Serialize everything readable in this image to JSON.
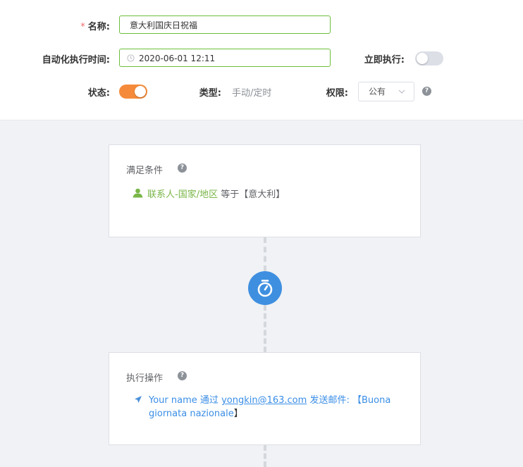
{
  "form": {
    "name_label": "名称:",
    "name_required_mark": "*",
    "name_value": "意大利国庆日祝福",
    "time_label": "自动化执行时间:",
    "time_value": "2020-06-01 12:11",
    "run_now_label": "立即执行:",
    "run_now_on": false,
    "status_label": "状态:",
    "status_on": true,
    "type_label": "类型:",
    "type_value": "手动/定时",
    "permission_label": "权限:",
    "permission_value": "公有"
  },
  "condition_card": {
    "title": "满足条件",
    "field": "联系人-国家/地区",
    "operator": "等于",
    "value": "【意大利】"
  },
  "action_card": {
    "title": "执行操作",
    "sender": "Your name",
    "via": "通过",
    "email": "yongkin@163.com",
    "action": "发送邮件:",
    "subject_line1": "【Buona",
    "subject_line2": "giornata nazionale",
    "subject_close": "】"
  },
  "colors": {
    "accent_green": "#6cbf3c",
    "toggle_on": "#f58b3a",
    "toggle_off": "#dcdfe6",
    "timer_blue": "#3e8fe0",
    "link_blue": "#3a8ee6"
  },
  "icons": [
    "clock-icon",
    "chevron-down-icon",
    "help-icon",
    "user-icon",
    "timer-icon",
    "send-icon"
  ]
}
